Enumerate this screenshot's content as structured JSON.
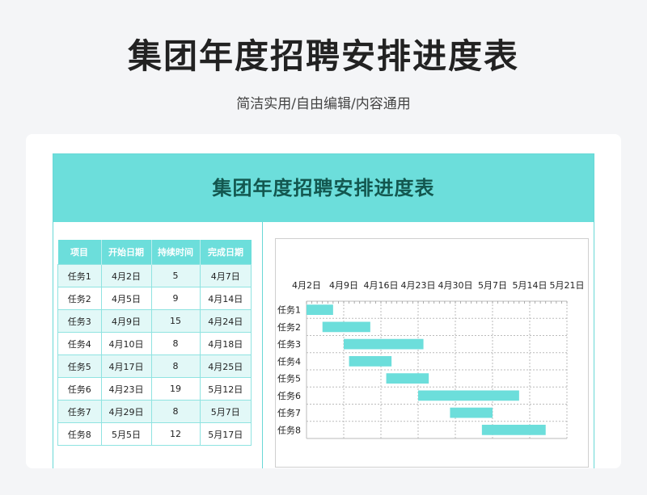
{
  "header": {
    "title": "集团年度招聘安排进度表",
    "subtitle": "简洁实用/自由编辑/内容通用"
  },
  "sheet": {
    "banner_title": "集团年度招聘安排进度表",
    "table": {
      "columns": [
        "项目",
        "开始日期",
        "持续时间",
        "完成日期"
      ],
      "rows": [
        [
          "任务1",
          "4月2日",
          "5",
          "4月7日"
        ],
        [
          "任务2",
          "4月5日",
          "9",
          "4月14日"
        ],
        [
          "任务3",
          "4月9日",
          "15",
          "4月24日"
        ],
        [
          "任务4",
          "4月10日",
          "8",
          "4月18日"
        ],
        [
          "任务5",
          "4月17日",
          "8",
          "4月25日"
        ],
        [
          "任务6",
          "4月23日",
          "19",
          "5月12日"
        ],
        [
          "任务7",
          "4月29日",
          "8",
          "5月7日"
        ],
        [
          "任务8",
          "5月5日",
          "12",
          "5月17日"
        ]
      ]
    }
  },
  "colors": {
    "accent": "#6cdedb",
    "banner_text": "#13574f",
    "bar": "#6cdedb"
  },
  "chart_data": {
    "type": "bar",
    "orientation": "horizontal-gantt",
    "categories": [
      "任务1",
      "任务2",
      "任务3",
      "任务4",
      "任务5",
      "任务6",
      "任务7",
      "任务8"
    ],
    "x_ticks": [
      "4月2日",
      "4月9日",
      "4月16日",
      "4月23日",
      "4月30日",
      "5月7日",
      "5月14日",
      "5月21日"
    ],
    "x_axis_position": "top",
    "grid": true,
    "series": [
      {
        "start_day": [
          0,
          3,
          7,
          8,
          15,
          21,
          27,
          33
        ],
        "duration_days": [
          5,
          9,
          15,
          8,
          8,
          19,
          8,
          12
        ]
      }
    ]
  }
}
